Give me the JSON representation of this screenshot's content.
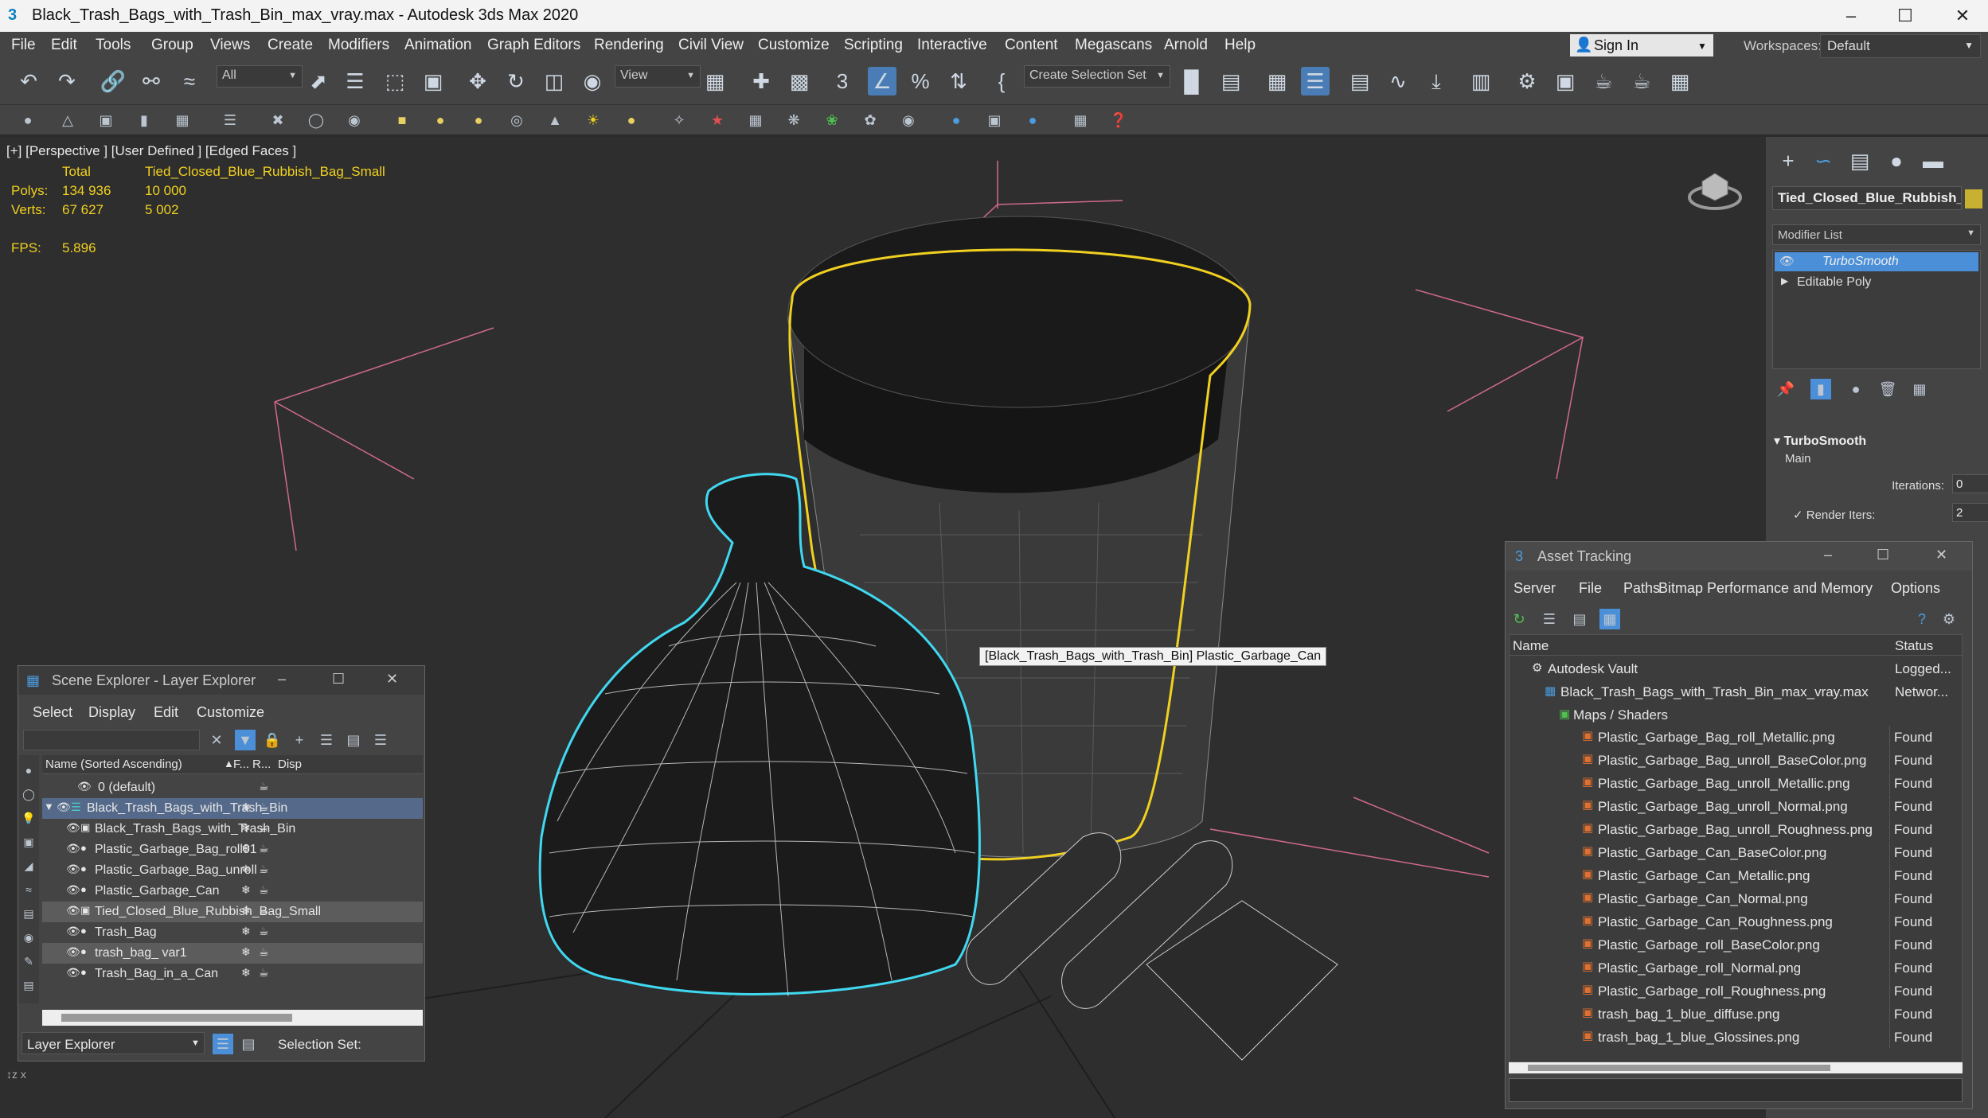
{
  "window": {
    "title": "Black_Trash_Bags_with_Trash_Bin_max_vray.max - Autodesk 3ds Max 2020"
  },
  "menu": [
    "File",
    "Edit",
    "Tools",
    "Group",
    "Views",
    "Create",
    "Modifiers",
    "Animation",
    "Graph Editors",
    "Rendering",
    "Civil View",
    "Customize",
    "Scripting",
    "Interactive",
    "Content",
    "Megascans",
    "Arnold",
    "Help"
  ],
  "signin": "Sign In",
  "workspaces": {
    "label": "Workspaces:",
    "value": "Default"
  },
  "toolbar": {
    "filter": "All",
    "refcoord": "View",
    "selection_set": "Create Selection Set"
  },
  "viewport": {
    "label": "[+] [Perspective ] [User Defined ] [Edged Faces ]",
    "total_label": "Total",
    "object_label": "Tied_Closed_Blue_Rubbish_Bag_Small",
    "polys_label": "Polys:",
    "polys_total": "134 936",
    "polys_obj": "10 000",
    "verts_label": "Verts:",
    "verts_total": "67 627",
    "verts_obj": "5 002",
    "fps_label": "FPS:",
    "fps_value": "5.896",
    "tooltip": "[Black_Trash_Bags_with_Trash_Bin] Plastic_Garbage_Can"
  },
  "scene_explorer": {
    "title": "Scene Explorer - Layer Explorer",
    "menu": [
      "Select",
      "Display",
      "Edit",
      "Customize"
    ],
    "col_name": "Name (Sorted Ascending)",
    "col_f": "F...",
    "col_r": "R...",
    "col_disp": "Disp",
    "rows": [
      {
        "name": "0 (default)"
      },
      {
        "name": "Black_Trash_Bags_with_Trash_Bin"
      },
      {
        "name": "Black_Trash_Bags_with_Trash_Bin"
      },
      {
        "name": "Plastic_Garbage_Bag_roll01"
      },
      {
        "name": "Plastic_Garbage_Bag_unroll"
      },
      {
        "name": "Plastic_Garbage_Can"
      },
      {
        "name": "Tied_Closed_Blue_Rubbish_Bag_Small"
      },
      {
        "name": "Trash_Bag"
      },
      {
        "name": "trash_bag_ var1"
      },
      {
        "name": "Trash_Bag_in_a_Can"
      }
    ],
    "footer_dropdown": "Layer Explorer",
    "selection_set_label": "Selection Set:"
  },
  "command_panel": {
    "object_name": "Tied_Closed_Blue_Rubbish_",
    "modifier_list": "Modifier List",
    "stack": [
      "TurboSmooth",
      "Editable Poly"
    ],
    "rollout_title": "TurboSmooth",
    "main_label": "Main",
    "iterations_label": "Iterations:",
    "iterations_value": "0",
    "render_iters_label": "Render Iters:",
    "render_iters_value": "2"
  },
  "asset_tracking": {
    "title": "Asset Tracking",
    "menu": [
      "Server",
      "File",
      "Paths",
      "Bitmap Performance and Memory",
      "Options"
    ],
    "col_name": "Name",
    "col_status": "Status",
    "rows": [
      {
        "name": "Autodesk Vault",
        "status": "Logged..."
      },
      {
        "name": "Black_Trash_Bags_with_Trash_Bin_max_vray.max",
        "status": "Networ..."
      },
      {
        "name": "Maps / Shaders",
        "status": ""
      },
      {
        "name": "Plastic_Garbage_Bag_roll_Metallic.png",
        "status": "Found"
      },
      {
        "name": "Plastic_Garbage_Bag_unroll_BaseColor.png",
        "status": "Found"
      },
      {
        "name": "Plastic_Garbage_Bag_unroll_Metallic.png",
        "status": "Found"
      },
      {
        "name": "Plastic_Garbage_Bag_unroll_Normal.png",
        "status": "Found"
      },
      {
        "name": "Plastic_Garbage_Bag_unroll_Roughness.png",
        "status": "Found"
      },
      {
        "name": "Plastic_Garbage_Can_BaseColor.png",
        "status": "Found"
      },
      {
        "name": "Plastic_Garbage_Can_Metallic.png",
        "status": "Found"
      },
      {
        "name": "Plastic_Garbage_Can_Normal.png",
        "status": "Found"
      },
      {
        "name": "Plastic_Garbage_Can_Roughness.png",
        "status": "Found"
      },
      {
        "name": "Plastic_Garbage_roll_BaseColor.png",
        "status": "Found"
      },
      {
        "name": "Plastic_Garbage_roll_Normal.png",
        "status": "Found"
      },
      {
        "name": "Plastic_Garbage_roll_Roughness.png",
        "status": "Found"
      },
      {
        "name": "trash_bag_1_blue_diffuse.png",
        "status": "Found"
      },
      {
        "name": "trash_bag_1_blue_Glossines.png",
        "status": "Found"
      }
    ]
  },
  "colors": {
    "selection_yellow": "#f0d020",
    "selection_cyan": "#40d8f0",
    "camera_pink": "#d06a8a",
    "accent_blue": "#4a8fd8"
  }
}
